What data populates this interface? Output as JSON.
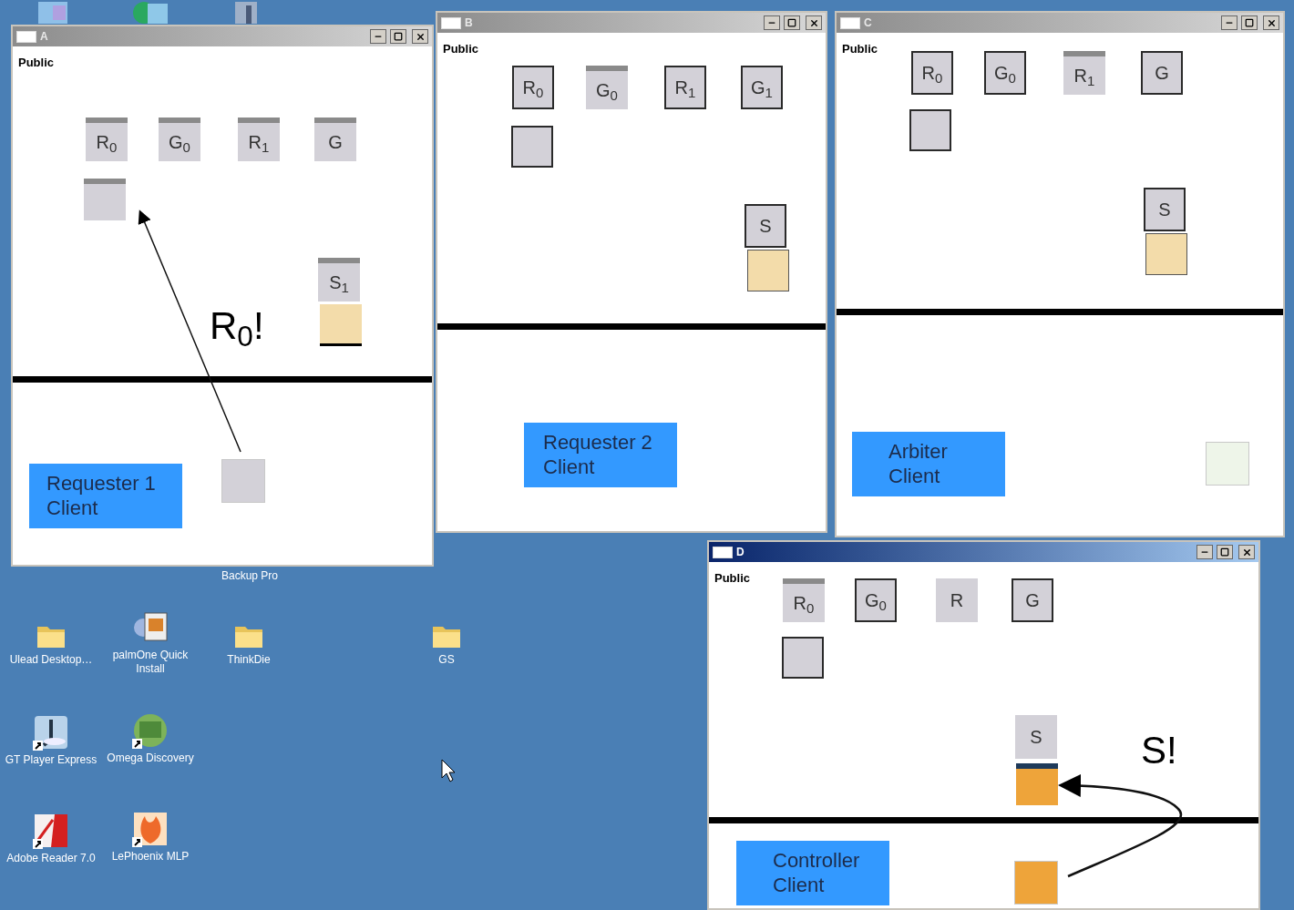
{
  "desktop": {
    "icons": [
      {
        "label": "Backup Pro",
        "kind": "hidden",
        "shortcut": false
      },
      {
        "label": "Ulead Desktop…",
        "kind": "folder",
        "shortcut": false
      },
      {
        "label": "palmOne Quick Install",
        "kind": "installer",
        "shortcut": false
      },
      {
        "label": "ThinkDie",
        "kind": "folder",
        "shortcut": false
      },
      {
        "label": "GS",
        "kind": "folder",
        "shortcut": false
      },
      {
        "label": "GT Player Express",
        "kind": "player",
        "shortcut": true
      },
      {
        "label": "Omega Discovery",
        "kind": "globe",
        "shortcut": true
      },
      {
        "label": "Adobe Reader 7.0",
        "kind": "pdf",
        "shortcut": true
      },
      {
        "label": "LePhoenix MLP",
        "kind": "flame",
        "shortcut": true
      }
    ]
  },
  "windows": [
    {
      "title": "A",
      "active": false,
      "label": "Public",
      "tokens": [
        {
          "label": "R$_{0}$",
          "kind": "bar"
        },
        {
          "label": "G$_{0}$",
          "kind": "bar"
        },
        {
          "label": "R$_{1}$",
          "kind": "bar"
        },
        {
          "label": "G",
          "kind": "bar"
        }
      ],
      "spare": {
        "kind": "bar",
        "color": "#d3d1d8"
      },
      "resource": {
        "label": "S$_{1}$",
        "kind": "bar"
      },
      "buffer": {
        "color": "#f3dcaa",
        "kind": "underlined"
      },
      "shout": "R$_{0}$!",
      "arrow": {
        "kind": "straight"
      },
      "client": "Requester 1 Client",
      "local": {
        "color": "#d3d1d8"
      }
    },
    {
      "title": "B",
      "active": false,
      "label": "Public",
      "tokens": [
        {
          "label": "R$_{0}$",
          "kind": "framed"
        },
        {
          "label": "G$_{0}$",
          "kind": "bar"
        },
        {
          "label": "R$_{1}$",
          "kind": "framed"
        },
        {
          "label": "G$_{1}$",
          "kind": "framed"
        }
      ],
      "spare": {
        "kind": "framed",
        "color": "#d3d1d8"
      },
      "resource": {
        "label": "S",
        "kind": "framed"
      },
      "buffer": {
        "color": "#f3dcaa",
        "kind": "framed"
      },
      "client": "Requester 2 Client"
    },
    {
      "title": "C",
      "active": false,
      "label": "Public",
      "tokens": [
        {
          "label": "R$_{0}$",
          "kind": "framed"
        },
        {
          "label": "G$_{0}$",
          "kind": "framed"
        },
        {
          "label": "R$_{1}$",
          "kind": "bar"
        },
        {
          "label": "G",
          "kind": "framed"
        }
      ],
      "spare": {
        "kind": "framed",
        "color": "#d3d1d8"
      },
      "resource": {
        "label": "S",
        "kind": "framed"
      },
      "buffer": {
        "color": "#f3dcaa",
        "kind": "framed"
      },
      "client": "Arbiter Client",
      "local": {
        "color": "#eef5e9"
      }
    },
    {
      "title": "D",
      "active": true,
      "label": "Public",
      "tokens": [
        {
          "label": "R$_{0}$",
          "kind": "bar"
        },
        {
          "label": "G$_{0}$",
          "kind": "framed"
        },
        {
          "label": "R",
          "kind": "plain"
        },
        {
          "label": "G",
          "kind": "framed"
        }
      ],
      "spare": {
        "kind": "framed",
        "color": "#d3d1d8"
      },
      "resource": {
        "label": "S",
        "kind": "plain"
      },
      "buffer": {
        "color": "#eea43a",
        "kind": "topbar"
      },
      "shout": "S!",
      "arrow": {
        "kind": "curved"
      },
      "client": "Controller Client",
      "local": {
        "color": "#eea43a"
      }
    }
  ]
}
